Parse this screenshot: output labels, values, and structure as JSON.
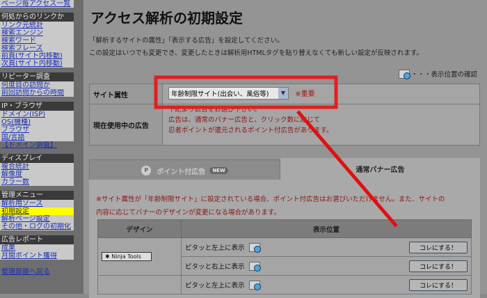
{
  "sidebar": {
    "top_link": "ページ毎アクセス一覧",
    "sections": [
      {
        "title": "何処からのリンクか",
        "items": [
          "リンク元統計",
          "検索エンジン",
          "検索ワード",
          "検索フレーズ",
          "前頁(サイト内移動)",
          "次頁(サイト内移動)"
        ]
      },
      {
        "title": "リピーター調査",
        "items": [
          "何度目の訪問か",
          "前回訪問からの時間"
        ]
      },
      {
        "title": "IP・ブラウザ",
        "items": [
          "ドメイン(ISP)",
          "OS(機種)",
          "ブラウザ",
          "国/言語"
        ],
        "extra": "【ドメイン調査】"
      },
      {
        "title": "ディスプレイ",
        "items": [
          "複合統計",
          "解像度",
          "カラー数"
        ]
      },
      {
        "title": "管理メニュー",
        "items": [
          "解析用ソース",
          "初期設定",
          "解析ページ設定",
          "その他・ログの初期化"
        ],
        "selected": "初期設定"
      },
      {
        "title": "広告レポート",
        "items": [
          "成果",
          "月間ポイント獲得"
        ]
      }
    ],
    "back_link": "管理部屋へ戻る"
  },
  "main": {
    "title": "アクセス解析の初期設定",
    "intro1": "「解析するサイトの属性」「表示する広告」を設定してください。",
    "intro2": "この設定はいつでも変更でき、変更したときは解析用HTMLタグを貼り替えなくても新しい設定が反映されます。",
    "confirm": "・・・表示位置の確認",
    "site_attr_label": "サイト属性",
    "site_attr_value": "年齢制限サイト(出会い、風俗等)",
    "important": "※重要",
    "current_ad_label": "現在使用中の広告",
    "current_ad_lines": [
      "下記より広告をお選び下さい。",
      "広告は、通常のバナー広告と、クリック数に応じて",
      "忍者ポイントが還元されるポイント付広告があります。"
    ],
    "tabs": {
      "point": "ポイント付広告",
      "new_badge": "NEW",
      "normal": "通常バナー広告",
      "active": "normal"
    },
    "note1": "※サイト属性が「年齢制限サイト」に設定されている場合、ポイント付広告はお選びいただけません。また、サイトの",
    "note2": "内容に応じてバナーのデザインが変更になる場合があります。",
    "table": {
      "headers": [
        "デザイン",
        "表示位置"
      ],
      "design_label": "Ninja Tools",
      "rows": [
        {
          "position": "ピタッと左上に表示",
          "button": "コレにする！"
        },
        {
          "position": "ピタッと右上に表示",
          "button": "コレにする！"
        },
        {
          "position": "ピタッと左上に表示",
          "button": "コレにする！"
        }
      ]
    }
  },
  "annotation_color": "#e02020"
}
